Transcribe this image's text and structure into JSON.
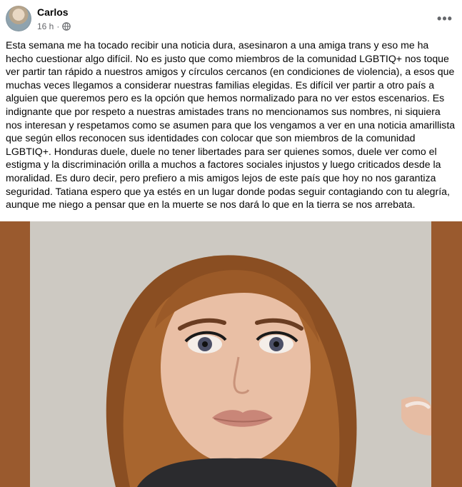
{
  "post": {
    "author_name": "Carlos",
    "timestamp": "16 h",
    "separator": "·",
    "audience_icon": "globe-icon",
    "more_icon": "more-horizontal-icon",
    "more_label": "•••",
    "text": "Esta semana me ha tocado recibir una noticia dura, asesinaron a una amiga trans y eso me ha hecho cuestionar algo difícil. No es justo que como miembros de la comunidad LGBTIQ+ nos toque ver partir tan rápido a nuestros amigos y círculos cercanos (en condiciones de violencia), a esos que muchas veces llegamos a considerar nuestras familias elegidas. Es difícil ver partir a otro país a alguien que queremos pero es la opción que hemos normalizado para no ver estos escenarios. Es indignante que por respeto a nuestras amistades trans no mencionamos sus nombres, ni siquiera nos interesan y respetamos como se asumen para que los vengamos a ver en una noticia amarillista que según ellos reconocen sus identidades con colocar que son miembros de la comunidad LGBTIQ+. Honduras duele, duele no tener libertades para ser quienes somos, duele ver como el estigma y la discriminación orilla a muchos a factores sociales injustos y luego criticados desde la moralidad. Es duro decir, pero prefiero a mis amigos lejos de este país que hoy no nos garantiza seguridad. Tatiana espero que ya estés en un lugar donde podas seguir contagiando con tu alegría, aunque me niego a pensar que en la muerte se nos dará lo que en la tierra se nos arrebata."
  },
  "colors": {
    "text_primary": "#050505",
    "text_secondary": "#65676b",
    "photo_border": "#9a5a2e",
    "background": "#ffffff"
  }
}
